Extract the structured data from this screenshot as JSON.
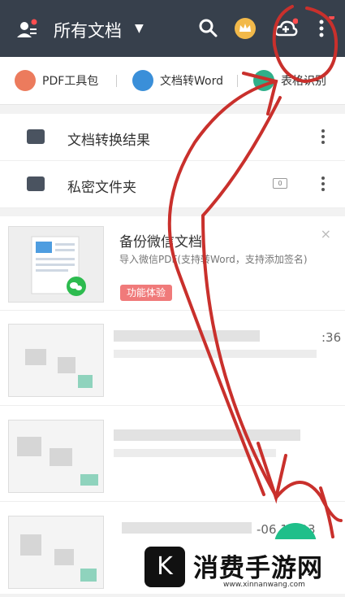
{
  "header": {
    "title": "所有文档",
    "bg": "#37404c"
  },
  "shortcuts": [
    {
      "label": "PDF工具包",
      "icon": "briefcase-icon",
      "color": "#ec7b5d"
    },
    {
      "label": "文档转Word",
      "icon": "word-icon",
      "color": "#3a8fd9"
    },
    {
      "label": "表格识别",
      "icon": "table-scan-icon",
      "color": "#2fb08a"
    }
  ],
  "folders": [
    {
      "label": "文档转换结果",
      "icon": "convert-folder-icon"
    },
    {
      "label": "私密文件夹",
      "icon": "private-folder-icon",
      "count": "0"
    }
  ],
  "promo": {
    "title": "备份微信文档",
    "desc": "导入微信PDF(支持转Word，支持添加签名)",
    "tag": "功能体验",
    "close": "×"
  },
  "docs": [
    {
      "time": ":36"
    },
    {
      "time": ""
    },
    {
      "time": "-06 13:03"
    }
  ],
  "watermark": {
    "logo": "K",
    "text": "消费手游网",
    "url": "www.xinnanwang.com"
  },
  "annotation_color": "#c9302c"
}
